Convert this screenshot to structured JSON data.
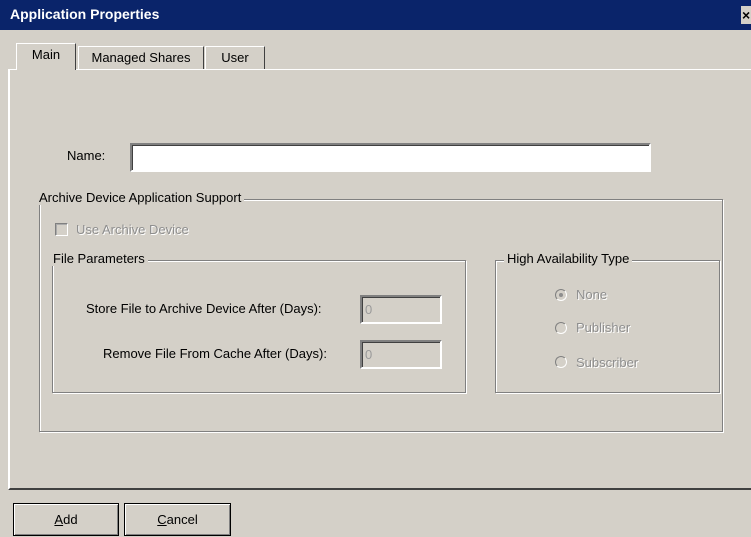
{
  "window": {
    "title": "Application Properties",
    "close_glyph": "×"
  },
  "tabs": [
    {
      "label": "Main",
      "active": true
    },
    {
      "label": "Managed Shares",
      "active": false
    },
    {
      "label": "User",
      "active": false
    }
  ],
  "main": {
    "name_label": "Name:",
    "name_value": "",
    "archive_group": {
      "legend": "Archive Device Application Support",
      "use_archive_label": "Use Archive Device",
      "use_archive_checked": false,
      "file_params": {
        "legend": "File Parameters",
        "store_label": "Store File to Archive Device After (Days):",
        "store_value": "0",
        "remove_label": "Remove File From Cache After (Days):",
        "remove_value": "0"
      },
      "ha_type": {
        "legend": "High Availability Type",
        "options": [
          {
            "label": "None",
            "selected": true
          },
          {
            "label": "Publisher",
            "selected": false
          },
          {
            "label": "Subscriber",
            "selected": false
          }
        ]
      }
    }
  },
  "buttons": {
    "add": {
      "mnemonic": "A",
      "rest": "dd"
    },
    "cancel": {
      "mnemonic": "C",
      "rest": "ancel"
    }
  }
}
